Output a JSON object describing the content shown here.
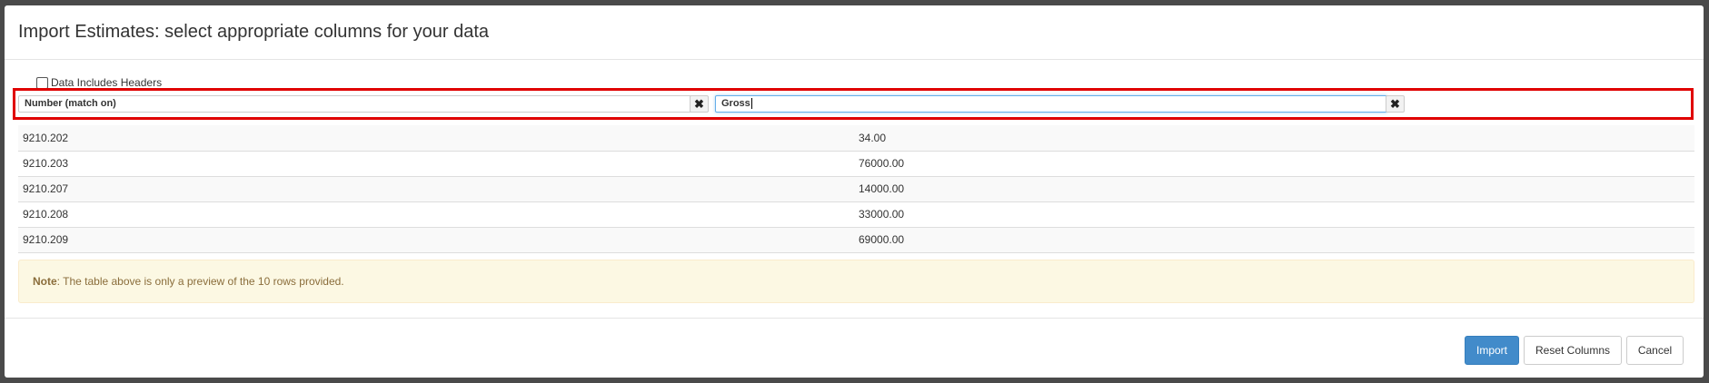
{
  "dialog": {
    "title": "Import Estimates: select appropriate columns for your data"
  },
  "options": {
    "headers_label": "Data Includes Headers",
    "headers_checked": false
  },
  "columns": [
    {
      "label": "Number (match on)",
      "clear_icon": "✖"
    },
    {
      "label": "Gross",
      "clear_icon": "✖"
    }
  ],
  "rows": [
    [
      "9210.202",
      "34.00"
    ],
    [
      "9210.203",
      "76000.00"
    ],
    [
      "9210.207",
      "14000.00"
    ],
    [
      "9210.208",
      "33000.00"
    ],
    [
      "9210.209",
      "69000.00"
    ]
  ],
  "note": {
    "label": "Note",
    "text": ": The table above is only a preview of the 10 rows provided."
  },
  "footer": {
    "import_label": "Import",
    "reset_label": "Reset Columns",
    "cancel_label": "Cancel"
  },
  "colors": {
    "primary": "#428bca",
    "highlight": "#e00000",
    "note_bg": "#fcf8e3",
    "note_text": "#8a6d3b"
  }
}
